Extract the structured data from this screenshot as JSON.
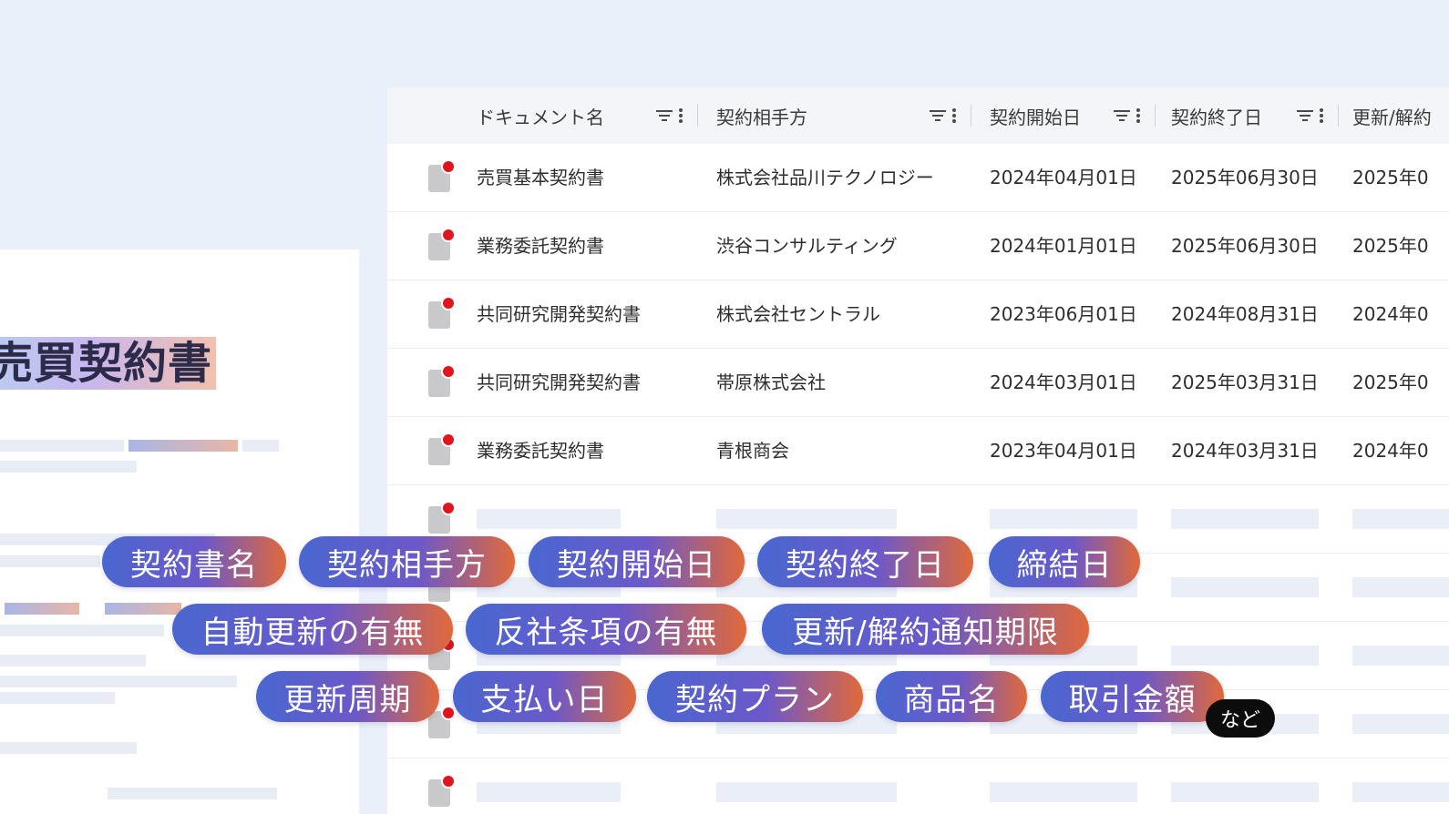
{
  "document_preview": {
    "title": "売買契約書"
  },
  "table": {
    "columns": [
      {
        "label": "ドキュメント名"
      },
      {
        "label": "契約相手方"
      },
      {
        "label": "契約開始日"
      },
      {
        "label": "契約終了日"
      },
      {
        "label": "更新/解約"
      }
    ],
    "rows": [
      {
        "name": "売買基本契約書",
        "counterparty": "株式会社品川テクノロジー",
        "start": "2024年04月01日",
        "end": "2025年06月30日",
        "renewal": "2025年0"
      },
      {
        "name": "業務委託契約書",
        "counterparty": "渋谷コンサルティング",
        "start": "2024年01月01日",
        "end": "2025年06月30日",
        "renewal": "2025年0"
      },
      {
        "name": "共同研究開発契約書",
        "counterparty": "株式会社セントラル",
        "start": "2023年06月01日",
        "end": "2024年08月31日",
        "renewal": "2024年0"
      },
      {
        "name": "共同研究開発契約書",
        "counterparty": "帯原株式会社",
        "start": "2024年03月01日",
        "end": "2025年03月31日",
        "renewal": "2025年0"
      },
      {
        "name": "業務委託契約書",
        "counterparty": "青根商会",
        "start": "2023年04月01日",
        "end": "2024年03月31日",
        "renewal": "2024年0"
      }
    ]
  },
  "tags": [
    "契約書名",
    "契約相手方",
    "契約開始日",
    "契約終了日",
    "締結日",
    "自動更新の有無",
    "反社条項の有無",
    "更新/解約通知期限",
    "更新周期",
    "支払い日",
    "契約プラン",
    "商品名",
    "取引金額"
  ],
  "etc_badge": "など",
  "colors": {
    "background": "#eaf0f9",
    "tag_gradient_start": "#4a67d0",
    "tag_gradient_end": "#e0693a",
    "status_dot": "#e0151d"
  }
}
